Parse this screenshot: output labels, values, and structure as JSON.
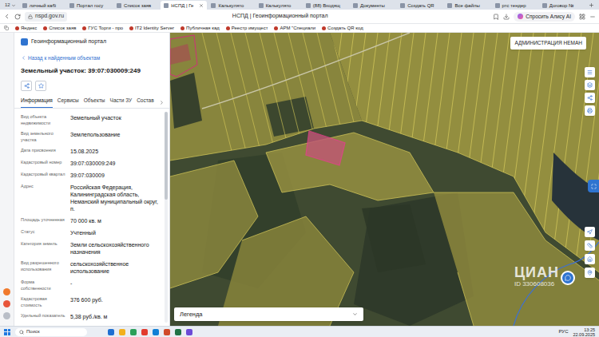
{
  "browser": {
    "tab_count": "12",
    "tabs": [
      {
        "label": "личный кабі",
        "selected": false
      },
      {
        "label": "Портал госу",
        "selected": false
      },
      {
        "label": "Список заяв",
        "selected": false
      },
      {
        "label": "НСПД | Ге",
        "selected": true
      },
      {
        "label": "Калькулято",
        "selected": false
      },
      {
        "label": "Калькулято",
        "selected": false
      },
      {
        "label": "(88) Входящ",
        "selected": false
      },
      {
        "label": "Документы",
        "selected": false
      },
      {
        "label": "Создать QR",
        "selected": false
      },
      {
        "label": "Все файлы",
        "selected": false
      },
      {
        "label": "ртс тендер",
        "selected": false
      },
      {
        "label": "Договор №",
        "selected": false
      }
    ],
    "address": "nspd.gov.ru",
    "page_title": "НСПД | Геоинформационный портал",
    "alice_button": "Спросить Алису AI",
    "bookmarks": [
      "Яндекс",
      "Список заяв",
      "ГУС Торги - про",
      "IT2 Identity Server",
      "Публичная кад",
      "Реестр имущест",
      "АРМ \"Специали",
      "Создать QR код"
    ]
  },
  "panel": {
    "portal_name": "Геоинформационный портал",
    "back_link": "Назад к найденным объектам",
    "title": "Земельный участок: 39:07:030009:249",
    "tabs": [
      {
        "label": "Информация",
        "selected": true
      },
      {
        "label": "Сервисы",
        "selected": false
      },
      {
        "label": "Объекты",
        "selected": false
      },
      {
        "label": "Части ЗУ",
        "selected": false
      },
      {
        "label": "Состав",
        "selected": false
      }
    ],
    "fields": [
      {
        "label": "Вид объекта недвижимости",
        "value": "Земельный участок"
      },
      {
        "label": "Вид земельного участка",
        "value": "Землепользование"
      },
      {
        "label": "Дата присвоения",
        "value": "15.08.2025"
      },
      {
        "label": "Кадастровый номер",
        "value": "39:07:030009:249"
      },
      {
        "label": "Кадастровый квартал",
        "value": "39:07:030009"
      },
      {
        "label": "Адрес",
        "value": "Российская Федерация, Калининградская область, Неманский муниципальный округ, п."
      },
      {
        "label": "Площадь уточненная",
        "value": "70 000 кв. м"
      },
      {
        "label": "Статус",
        "value": "Учтенный"
      },
      {
        "label": "Категория земель",
        "value": "Земли сельскохозяйственного назначения"
      },
      {
        "label": "Вид разрешенного использования",
        "value": "сельскохозяйственное использование"
      },
      {
        "label": "Форма собственности",
        "value": "-"
      },
      {
        "label": "Кадастровая стоимость",
        "value": "376 600 руб."
      },
      {
        "label": "Удельный показатель",
        "value": "5,38 руб./кв. м"
      }
    ]
  },
  "map": {
    "region_select": "АДМИНИСТРАЦИЯ НЕМАН",
    "legend": "Легенда",
    "watermark": {
      "brand": "ЦИАН",
      "id": "ID 330608036"
    }
  },
  "taskbar": {
    "search": "Поиск",
    "lang": "РУС",
    "time": "13:25",
    "date": "22.09.2025"
  }
}
